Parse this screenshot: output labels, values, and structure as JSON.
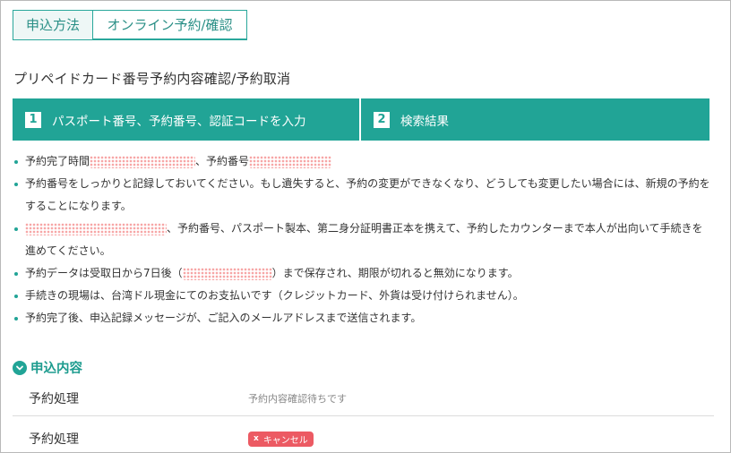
{
  "tabs": [
    {
      "label": "申込方法",
      "active": true
    },
    {
      "label": "オンライン予約/確認",
      "active": false
    }
  ],
  "page_title": "プリペイドカード番号予約内容確認/予約取消",
  "steps": [
    {
      "number": "1",
      "label": "パスポート番号、予約番号、認証コードを入力"
    },
    {
      "number": "2",
      "label": "検索結果"
    }
  ],
  "notes": {
    "n1_a": "予約完了時間",
    "n1_b": "、予約番号",
    "n2": "予約番号をしっかりと記録しておいてください。もし遺失すると、予約の変更ができなくなり、どうしても変更したい場合には、新規の予約をすることになります。",
    "n3": "、予約番号、パスポート製本、第二身分証明書正本を携えて、予約したカウンターまで本人が出向いて手続きを進めてください。",
    "n4_a": "予約データは受取日から7日後（",
    "n4_b": "）まで保存され、期限が切れると無効になります。",
    "n5": "手続きの現場は、台湾ドル現金にてのお支払いです（クレジットカード、外貨は受け付けられません）。",
    "n6": "予約完了後、申込記録メッセージが、ご記入のメールアドレスまで送信されます。"
  },
  "section": {
    "title": "申込内容"
  },
  "rows": [
    {
      "label": "予約処理",
      "value": "予約内容確認待ちです"
    },
    {
      "label": "予約処理",
      "badge": "キャンセル",
      "badge_icon": "x"
    }
  ],
  "colors": {
    "accent": "#21a496",
    "badge": "#ec5a63"
  }
}
